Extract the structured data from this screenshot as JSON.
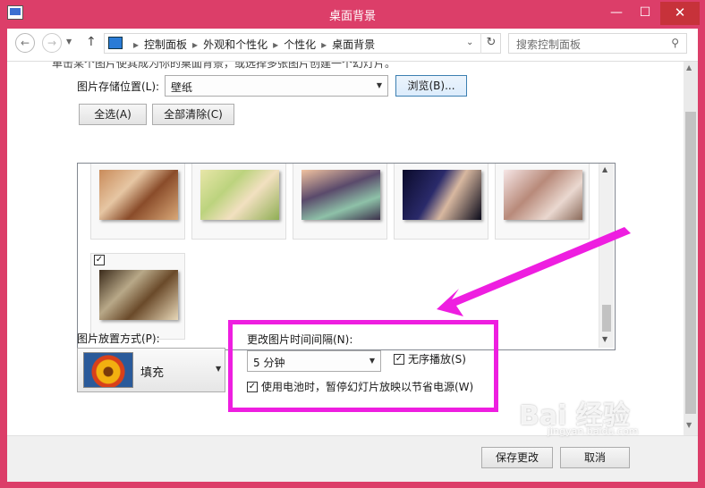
{
  "window": {
    "title": "桌面背景",
    "controls": {
      "minimize": "—",
      "maximize": "☐",
      "close": "✕"
    }
  },
  "nav": {
    "breadcrumbs": [
      "控制面板",
      "外观和个性化",
      "个性化",
      "桌面背景"
    ],
    "search_placeholder": "搜索控制面板"
  },
  "content": {
    "partial_heading": "单击某个图片使其成为你的桌面背景，或选择多张图片创建一个幻灯片。",
    "location_label": "图片存储位置(L):",
    "location_value": "壁纸",
    "browse_label": "浏览(B)...",
    "select_all_label": "全选(A)",
    "clear_all_label": "全部清除(C)",
    "pictures": [
      {
        "checked": true,
        "swatch": "t1"
      },
      {
        "checked": true,
        "swatch": "t2"
      },
      {
        "checked": true,
        "swatch": "t3"
      },
      {
        "checked": true,
        "swatch": "t4"
      },
      {
        "checked": true,
        "swatch": "t5"
      },
      {
        "checked": true,
        "swatch": "t6"
      }
    ],
    "position_label": "图片放置方式(P):",
    "position_value": "填充",
    "interval_label": "更改图片时间间隔(N):",
    "interval_value": "5 分钟",
    "shuffle_label": "无序播放(S)",
    "shuffle_checked": true,
    "battery_label": "使用电池时，暂停幻灯片放映以节省电源(W)",
    "battery_checked": true
  },
  "footer": {
    "save_label": "保存更改",
    "cancel_label": "取消"
  },
  "watermark": {
    "main": "Bai 经验",
    "sub": "jingyan.baidu.com"
  },
  "colors": {
    "highlight_box": "#ee1ee0",
    "arrow": "#ee1ee0",
    "titlebar": "#dc3e69"
  }
}
